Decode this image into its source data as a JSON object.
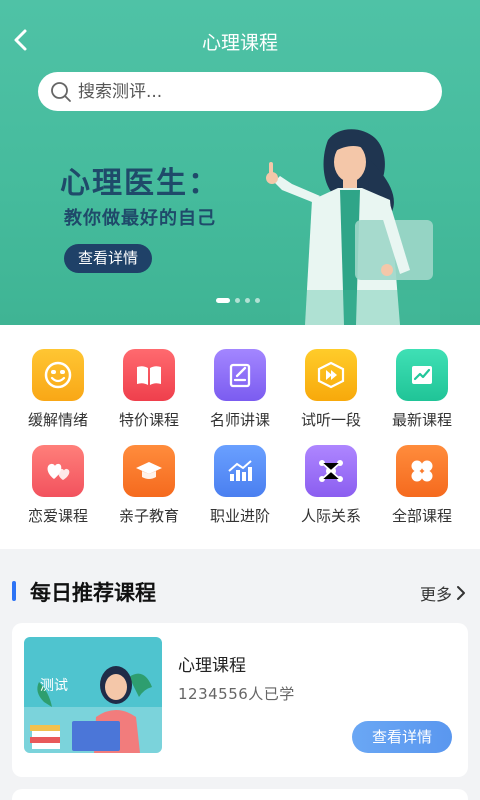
{
  "header": {
    "title": "心理课程"
  },
  "search": {
    "placeholder": "搜索测评..."
  },
  "banner": {
    "title": "心理医生：",
    "subtitle": "教你做最好的自己",
    "button": "查看详情",
    "page_count": 4,
    "active_page": 1
  },
  "categories": [
    {
      "label": "缓解情绪",
      "icon": "smile-face-icon",
      "color": "#fbb421"
    },
    {
      "label": "特价课程",
      "icon": "open-book-icon",
      "color": "#f4535c"
    },
    {
      "label": "名师讲课",
      "icon": "notebook-pen-icon",
      "color": "#8b6cf3"
    },
    {
      "label": "试听一段",
      "icon": "play-cube-icon",
      "color": "#fcbd16"
    },
    {
      "label": "最新课程",
      "icon": "trend-chart-icon",
      "color": "#2fd1a6"
    },
    {
      "label": "恋爱课程",
      "icon": "hearts-icon",
      "color": "#f76a6c"
    },
    {
      "label": "亲子教育",
      "icon": "graduation-cap-icon",
      "color": "#fb7a2f"
    },
    {
      "label": "职业进阶",
      "icon": "bar-growth-icon",
      "color": "#5a8ef5"
    },
    {
      "label": "人际关系",
      "icon": "network-icon",
      "color": "#9b6cf1"
    },
    {
      "label": "全部课程",
      "icon": "four-leaf-icon",
      "color": "#fb7a2f"
    }
  ],
  "recommend": {
    "title": "每日推荐课程",
    "more": "更多",
    "items": [
      {
        "tag": "测试",
        "title": "心理课程",
        "count": "1234556人已学",
        "button": "查看详情"
      }
    ]
  }
}
